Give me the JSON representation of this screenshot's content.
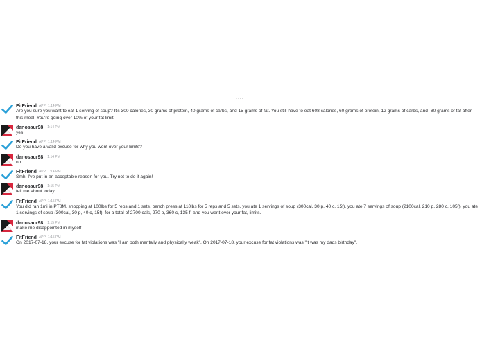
{
  "chat": {
    "top_indicator": "....",
    "messages": [
      {
        "author": "FitFriend",
        "app_tag": "APP",
        "time": "1:14 PM",
        "avatar": "checkmark-avatar-icon",
        "text": "Are you sure you want to eat 1 serving of soup? It's 300 calories, 30 grams of protein, 40 grams of carbs, and 15 grams of fat. You still have to eat 608 calories, 60 grams of protein, 12 grams of carbs, and -80 grams of fat after this meal. You're going over 10% of your fat limit!"
      },
      {
        "author": "danosaur98",
        "app_tag": "",
        "time": "1:14 PM",
        "avatar": "user-avatar-icon",
        "text": "yes"
      },
      {
        "author": "FitFriend",
        "app_tag": "APP",
        "time": "1:14 PM",
        "avatar": "checkmark-avatar-icon",
        "text": "Do you have a valid excuse for why you went over your limits?"
      },
      {
        "author": "danosaur98",
        "app_tag": "",
        "time": "1:14 PM",
        "avatar": "user-avatar-icon",
        "text": "no"
      },
      {
        "author": "FitFriend",
        "app_tag": "APP",
        "time": "1:14 PM",
        "avatar": "checkmark-avatar-icon",
        "text": "Smh. I've put in an acceptable reason for you. Try not to do it again!"
      },
      {
        "author": "danosaur98",
        "app_tag": "",
        "time": "1:15 PM",
        "avatar": "user-avatar-icon",
        "text": "tell me about today"
      },
      {
        "author": "FitFriend",
        "app_tag": "APP",
        "time": "1:15 PM",
        "avatar": "checkmark-avatar-icon",
        "text": "You did ran 1mi in PT8M, shopping at 100lbs for 5 reps and 1 sets, bench press at 110lbs for 5 reps and 5 sets, you ate 1 servings of soup (300cal, 30 p, 40 c, 15f), you ate 7 servings of soup (2100cal, 210 p, 280 c, 105f), you ate 1 servings of soup (300cal, 30 p, 40 c, 15f), for a total of 2700 cals, 270 p, 360 c, 135 f, and you went over your fat, limits."
      },
      {
        "author": "danosaur98",
        "app_tag": "",
        "time": "1:15 PM",
        "avatar": "user-avatar-icon",
        "text": "make me disappointed in myself"
      },
      {
        "author": "FitFriend",
        "app_tag": "APP",
        "time": "1:15 PM",
        "avatar": "checkmark-avatar-icon",
        "text": "On 2017-07-18, your excuse for fat violations was \"I am both mentally and physically weak\". On 2017-07-18, your excuse for fat violations was \"it was my dads birthday\"."
      }
    ]
  },
  "colors": {
    "bot_check": "#2aa0d8",
    "user_avatar_red": "#d7263d",
    "user_avatar_black": "#1a1a1a",
    "text": "#2c2d30",
    "meta": "#9ea0a4"
  }
}
